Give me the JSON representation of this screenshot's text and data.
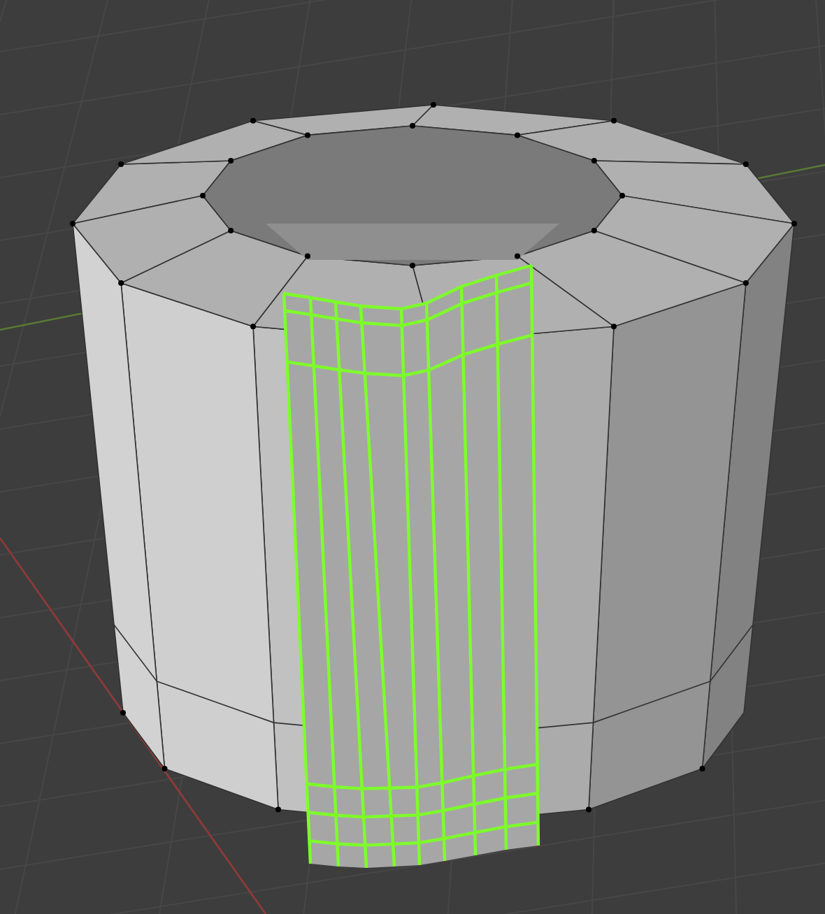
{
  "viewport": {
    "show_grid": true,
    "show_axes": true
  },
  "mesh": {
    "show_vertices": true,
    "handle_selected": true
  }
}
